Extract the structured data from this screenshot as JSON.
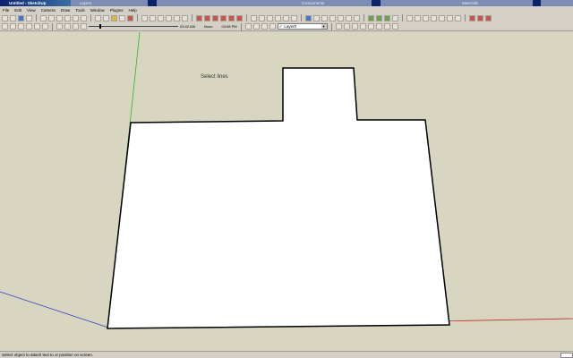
{
  "window": {
    "title": "Untitled - SketchUp",
    "panels": [
      "Layers",
      "Components",
      "Materials"
    ]
  },
  "menu": [
    "File",
    "Edit",
    "View",
    "Camera",
    "Draw",
    "Tools",
    "Window",
    "Plugins",
    "Help"
  ],
  "toolbar": {
    "layer_current": "Layer0",
    "layer_check": "✓",
    "shadow_time": "03:42 AM",
    "shadow_noon": "Noon",
    "shadow_end": "04:08 PM"
  },
  "viewport": {
    "hint_label": "Select lines",
    "colors": {
      "background": "#d8d6c0",
      "red_axis": "#c03030",
      "green_axis": "#30b030",
      "blue_axis": "#3040c0",
      "edge": "#000000",
      "face": "#ffffff"
    }
  },
  "statusbar": {
    "text": "Select object to attach text to or position on screen."
  }
}
